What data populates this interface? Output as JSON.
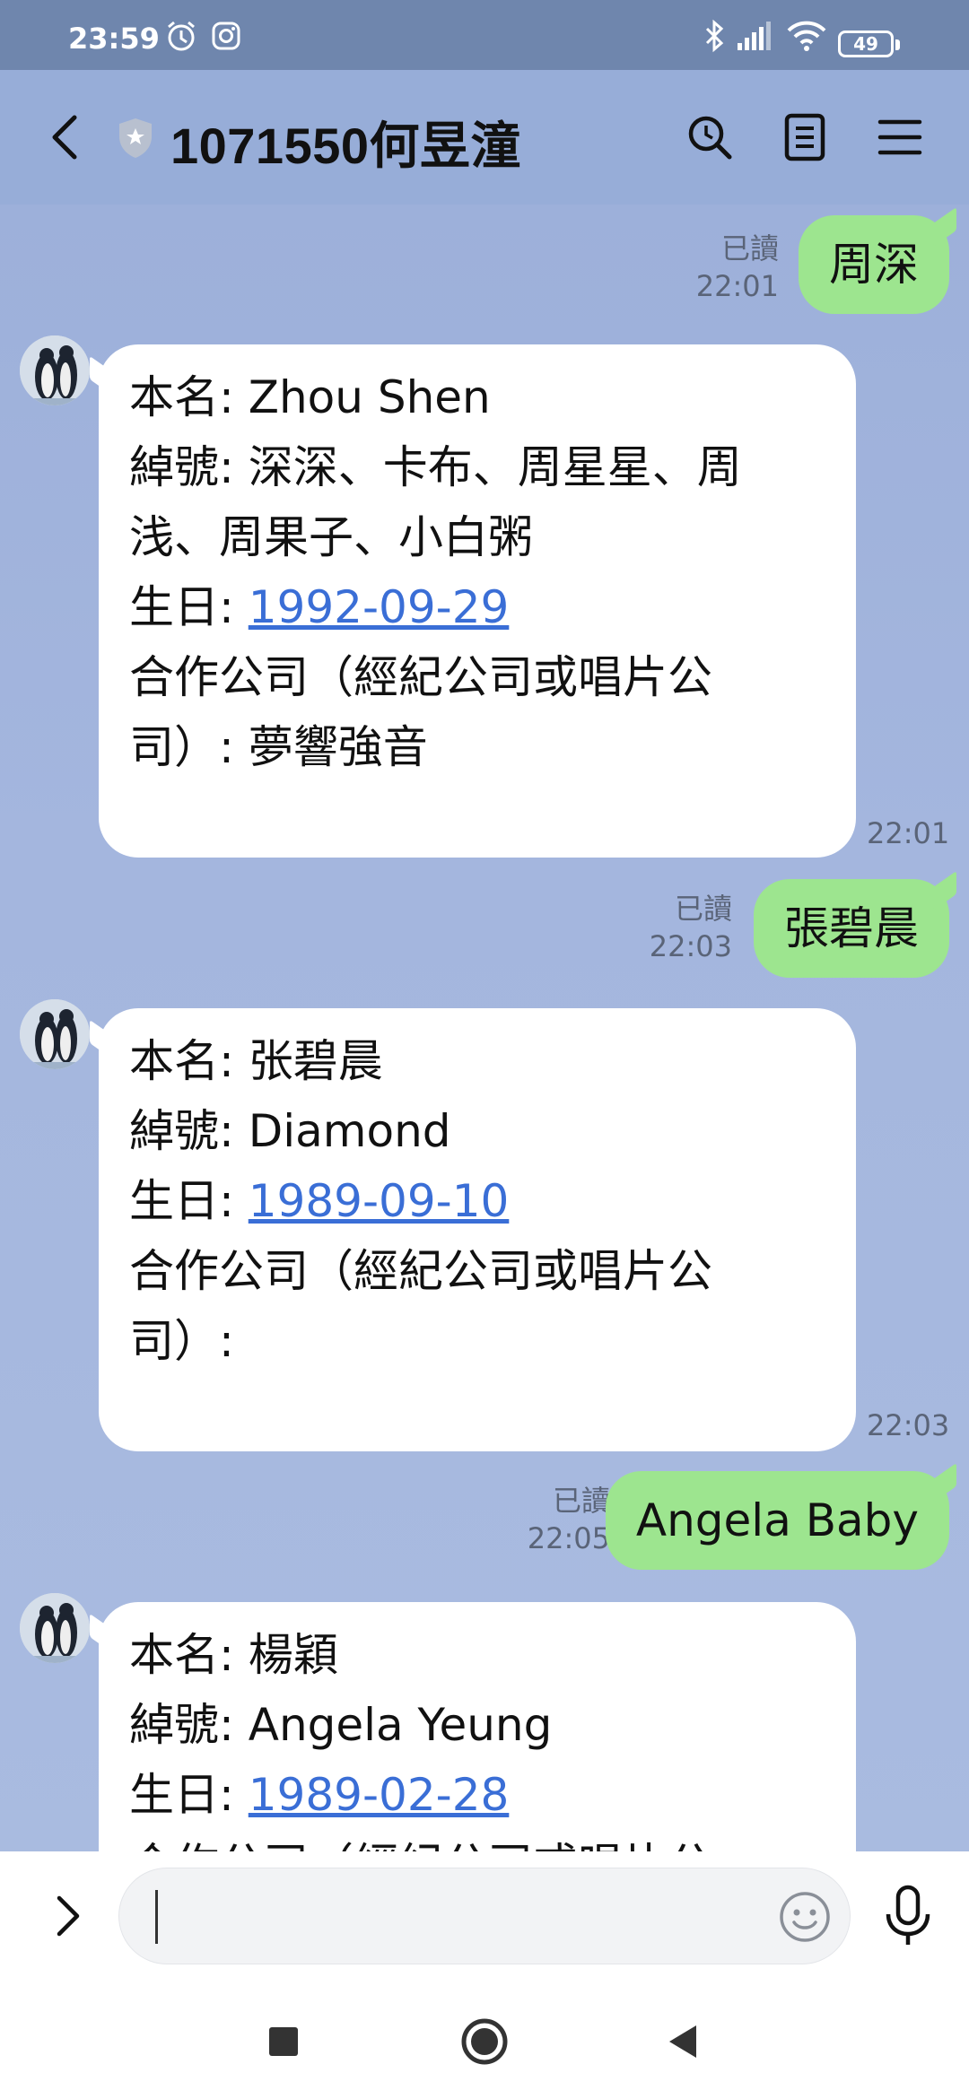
{
  "status_bar": {
    "time": "23:59",
    "battery": "49"
  },
  "header": {
    "title": "1071550何昱潼"
  },
  "messages": {
    "m1": {
      "text": "周深",
      "read": "已讀",
      "time": "22:01"
    },
    "m2": {
      "line1": "本名: Zhou Shen",
      "line2": "綽號: 深深、卡布、周星星、周",
      "line3": "浅、周果子、小白粥",
      "birthday_label": "生日: ",
      "birthday": "1992-09-29",
      "line5": "合作公司（經紀公司或唱片公",
      "line6": "司）: 夢響強音",
      "time": "22:01"
    },
    "m3": {
      "text": "張碧晨",
      "read": "已讀",
      "time": "22:03"
    },
    "m4": {
      "line1": "本名: 张碧晨",
      "line2": "綽號: Diamond",
      "birthday_label": "生日: ",
      "birthday": "1989-09-10",
      "line4": "合作公司（經紀公司或唱片公",
      "line5": "司）:",
      "time": "22:03"
    },
    "m5": {
      "text": "Angela Baby",
      "read": "已讀",
      "time": "22:05"
    },
    "m6": {
      "line1": "本名: 楊穎",
      "line2": "綽號: Angela Yeung",
      "birthday_label": "生日: ",
      "birthday": "1989-02-28",
      "line4": "合作公司（經紀公司或唱片公"
    }
  },
  "colors": {
    "chat_background": "#97add8",
    "outgoing_bubble": "#9de58f",
    "incoming_bubble": "#ffffff",
    "link": "#3a6ed6"
  },
  "icons": [
    "back-icon",
    "shield-icon",
    "search-icon",
    "notes-icon",
    "menu-icon",
    "alarm-icon",
    "instagram-icon",
    "bluetooth-icon",
    "signal-icon",
    "wifi-icon",
    "expand-icon",
    "emoji-icon",
    "mic-icon",
    "recent-apps-icon",
    "home-icon",
    "back-nav-icon"
  ]
}
